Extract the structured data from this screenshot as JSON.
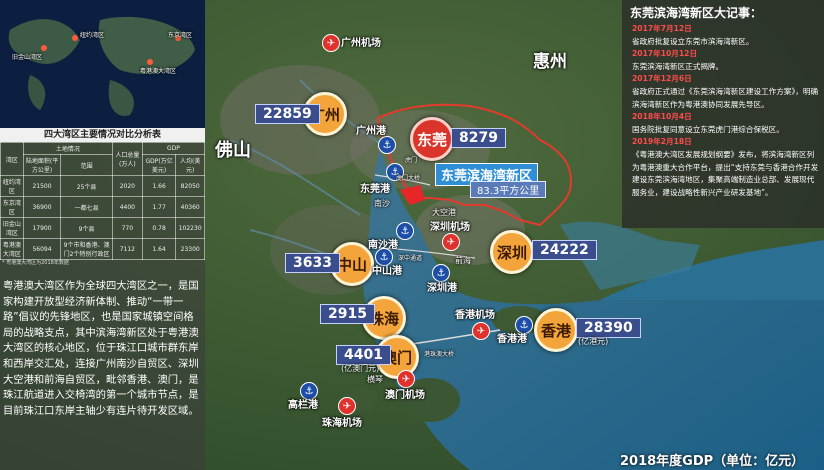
{
  "map": {
    "region_huizhou": "惠州",
    "region_foshan": "佛山",
    "new_area": {
      "title": "东莞滨海湾新区",
      "area": "83.3平方公里"
    },
    "cities": [
      {
        "name": "广州",
        "gdp": "22859",
        "style": "orange"
      },
      {
        "name": "东莞",
        "gdp": "8279",
        "style": "red"
      },
      {
        "name": "深圳",
        "gdp": "24222",
        "style": "orange"
      },
      {
        "name": "中山",
        "gdp": "3633",
        "style": "orange"
      },
      {
        "name": "珠海",
        "gdp": "2915",
        "style": "orange"
      },
      {
        "name": "澳门",
        "gdp": "4401",
        "gdp_note": "(亿澳门元)",
        "style": "orange"
      },
      {
        "name": "香港",
        "gdp": "28390",
        "gdp_note": "(亿港元)",
        "style": "orange"
      }
    ],
    "ports": [
      "广州港",
      "东莞港",
      "南沙港",
      "中山港",
      "深圳港",
      "香港港",
      "高栏港"
    ],
    "airports": [
      "广州机场",
      "深圳机场",
      "香港机场",
      "澳门机场",
      "珠海机场"
    ],
    "minor_labels": [
      "南沙",
      "前海",
      "虎门",
      "横琴",
      "港珠澳大桥",
      "大空港",
      "深中通道",
      "虎门大桥"
    ]
  },
  "left_panel": {
    "table_title": "四大湾区主要情况对比分析表",
    "table_headers": [
      "湾区",
      "陆地面积(平方公里)",
      "范围",
      "人口总量(万人)",
      "GDP(万亿美元)",
      "人均(美元)"
    ],
    "table_group_headers": [
      "土地情况",
      "GDP"
    ],
    "table_rows": [
      [
        "纽约湾区",
        "21500",
        "25个县",
        "2020",
        "1.66",
        "82050"
      ],
      [
        "东京湾区",
        "36900",
        "一都七县",
        "4400",
        "1.77",
        "40360"
      ],
      [
        "旧金山湾区",
        "17900",
        "9个县",
        "770",
        "0.78",
        "102230"
      ],
      [
        "粤港澳大湾区",
        "56094",
        "9个市和香港、澳门2个特别行政区",
        "7112",
        "1.64",
        "23300"
      ]
    ],
    "table_note": "* 粤港澳大湾区为2018年数据",
    "minimap_labels": [
      "纽约湾区",
      "东京湾区",
      "旧金山湾区",
      "粤港澳大湾区"
    ],
    "intro_text": "粤港澳大湾区作为全球四大湾区之一，是国家构建开放型经济新体制、推动“一带一路”倡议的先锋地区，也是国家城镇空间格局的战略支点，其中滨海湾新区处于粤港澳大湾区的核心地区，位于珠江口城市群东岸和西岸交汇处，连接广州南沙自贸区、深圳大空港和前海自贸区，毗邻香港、澳门，是珠江航道进入交椅湾的第一个城市节点，是目前珠江口东岸主轴少有连片待开发区域。"
  },
  "right_panel": {
    "title": "东莞滨海湾新区大记事：",
    "events": [
      {
        "date": "2017年7月12日",
        "text": "省政府批复设立东莞市滨海湾新区。"
      },
      {
        "date": "2017年10月12日",
        "text": "东莞滨海湾新区正式揭牌。"
      },
      {
        "date": "2017年12月6日",
        "text": "省政府正式通过《东莞滨海湾新区建设工作方案》，明确滨海湾新区作为粤港澳协同发展先导区。"
      },
      {
        "date": "2018年10月4日",
        "text": "国务院批复同意设立东莞虎门港综合保税区。"
      },
      {
        "date": "2019年2月18日",
        "text": "《粤港澳大湾区发展规划纲要》发布，将滨海湾新区列为粤港澳重大合作平台，提出“支持东莞与香港合作开发建设东莞滨海湾地区，集聚高端制造业总部、发展现代服务业，建设战略性新兴产业研发基地”。"
      }
    ]
  },
  "caption": "2018年度GDP（单位：亿元）",
  "colors": {
    "city_orange": "#f3a53b",
    "city_red": "#d9352b",
    "gdp_box": "#3a4d8d",
    "event_date": "#ff4c4c",
    "boundary": "#e23b2e"
  }
}
